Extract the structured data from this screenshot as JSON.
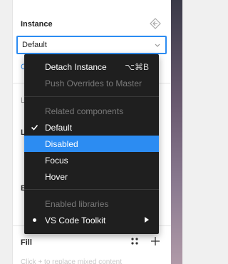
{
  "instance": {
    "title": "Instance",
    "selected_value": "Default"
  },
  "menu": {
    "detach_label": "Detach Instance",
    "detach_shortcut": "⌥⌘B",
    "push_overrides_label": "Push Overrides to Master",
    "related_header": "Related components",
    "variants": [
      "Default",
      "Disabled",
      "Focus",
      "Hover"
    ],
    "checked_variant": "Default",
    "highlighted_variant": "Disabled",
    "libraries_header": "Enabled libraries",
    "library_item": "VS Code Toolkit"
  },
  "fill": {
    "title": "Fill",
    "hint": "Click + to replace mixed content"
  },
  "colors": {
    "accent": "#2c8cf2",
    "menu_bg": "#1f1f1f"
  }
}
